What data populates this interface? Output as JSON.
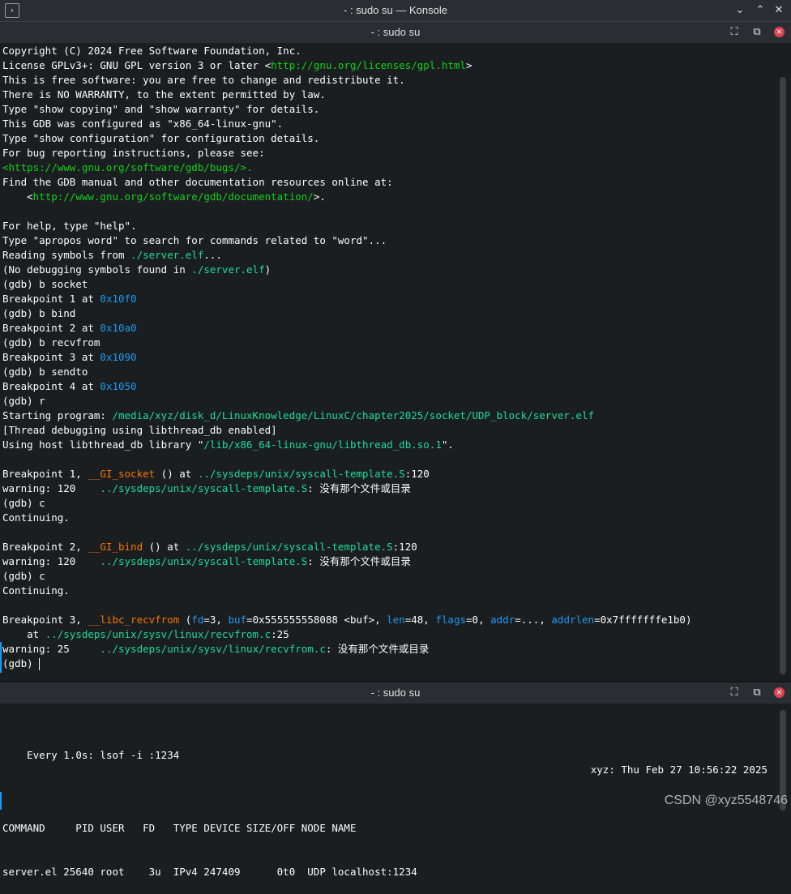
{
  "window": {
    "title": "- : sudo su — Konsole",
    "app_icon": "terminal-icon",
    "controls": [
      "chevron-down-icon",
      "chevron-up-icon",
      "close-icon"
    ]
  },
  "top_pane": {
    "title": "- : sudo su",
    "lines": [
      [
        {
          "t": "Copyright (C) 2024 Free Software Foundation, Inc."
        }
      ],
      [
        {
          "t": "License GPLv3+: GNU GPL version 3 or later <"
        },
        {
          "t": "http://gnu.org/licenses/gpl.html",
          "c": "gn"
        },
        {
          "t": ">"
        }
      ],
      [
        {
          "t": "This is free software: you are free to change and redistribute it."
        }
      ],
      [
        {
          "t": "There is NO WARRANTY, to the extent permitted by law."
        }
      ],
      [
        {
          "t": "Type \"show copying\" and \"show warranty\" for details."
        }
      ],
      [
        {
          "t": "This GDB was configured as \"x86_64-linux-gnu\"."
        }
      ],
      [
        {
          "t": "Type \"show configuration\" for configuration details."
        }
      ],
      [
        {
          "t": "For bug reporting instructions, please see:"
        }
      ],
      [
        {
          "t": "<https://www.gnu.org/software/gdb/bugs/>.",
          "c": "gn"
        }
      ],
      [
        {
          "t": "Find the GDB manual and other documentation resources online at:"
        }
      ],
      [
        {
          "t": "    <"
        },
        {
          "t": "http://www.gnu.org/software/gdb/documentation/",
          "c": "gn"
        },
        {
          "t": ">."
        }
      ],
      [
        {
          "t": ""
        }
      ],
      [
        {
          "t": "For help, type \"help\"."
        }
      ],
      [
        {
          "t": "Type \"apropos word\" to search for commands related to \"word\"..."
        }
      ],
      [
        {
          "t": "Reading symbols from "
        },
        {
          "t": "./server.elf",
          "c": "g"
        },
        {
          "t": "..."
        }
      ],
      [
        {
          "t": "(No debugging symbols found in "
        },
        {
          "t": "./server.elf",
          "c": "g"
        },
        {
          "t": ")"
        }
      ],
      [
        {
          "t": "(gdb) b socket"
        }
      ],
      [
        {
          "t": "Breakpoint 1 at "
        },
        {
          "t": "0x10f0",
          "c": "b"
        }
      ],
      [
        {
          "t": "(gdb) b bind"
        }
      ],
      [
        {
          "t": "Breakpoint 2 at "
        },
        {
          "t": "0x10a0",
          "c": "b"
        }
      ],
      [
        {
          "t": "(gdb) b recvfrom"
        }
      ],
      [
        {
          "t": "Breakpoint 3 at "
        },
        {
          "t": "0x1090",
          "c": "b"
        }
      ],
      [
        {
          "t": "(gdb) b sendto"
        }
      ],
      [
        {
          "t": "Breakpoint 4 at "
        },
        {
          "t": "0x1050",
          "c": "b"
        }
      ],
      [
        {
          "t": "(gdb) r"
        }
      ],
      [
        {
          "t": "Starting program: "
        },
        {
          "t": "/media/xyz/disk_d/LinuxKnowledge/LinuxC/chapter2025/socket/UDP_block/server.elf",
          "c": "g"
        }
      ],
      [
        {
          "t": "[Thread debugging using libthread_db enabled]"
        }
      ],
      [
        {
          "t": "Using host libthread_db library \""
        },
        {
          "t": "/lib/x86_64-linux-gnu/libthread_db.so.1",
          "c": "g"
        },
        {
          "t": "\"."
        }
      ],
      [
        {
          "t": ""
        }
      ],
      [
        {
          "t": "Breakpoint 1, "
        },
        {
          "t": "__GI_socket",
          "c": "o"
        },
        {
          "t": " () at "
        },
        {
          "t": "../sysdeps/unix/syscall-template.S",
          "c": "g"
        },
        {
          "t": ":120"
        }
      ],
      [
        {
          "t": "warning: 120    "
        },
        {
          "t": "../sysdeps/unix/syscall-template.S",
          "c": "g"
        },
        {
          "t": ": 没有那个文件或目录"
        }
      ],
      [
        {
          "t": "(gdb) c"
        }
      ],
      [
        {
          "t": "Continuing."
        }
      ],
      [
        {
          "t": ""
        }
      ],
      [
        {
          "t": "Breakpoint 2, "
        },
        {
          "t": "__GI_bind",
          "c": "o"
        },
        {
          "t": " () at "
        },
        {
          "t": "../sysdeps/unix/syscall-template.S",
          "c": "g"
        },
        {
          "t": ":120"
        }
      ],
      [
        {
          "t": "warning: 120    "
        },
        {
          "t": "../sysdeps/unix/syscall-template.S",
          "c": "g"
        },
        {
          "t": ": 没有那个文件或目录"
        }
      ],
      [
        {
          "t": "(gdb) c"
        }
      ],
      [
        {
          "t": "Continuing."
        }
      ],
      [
        {
          "t": ""
        }
      ],
      [
        {
          "t": "Breakpoint 3, "
        },
        {
          "t": "__libc_recvfrom",
          "c": "o"
        },
        {
          "t": " ("
        },
        {
          "t": "fd",
          "c": "b"
        },
        {
          "t": "=3, "
        },
        {
          "t": "buf",
          "c": "b"
        },
        {
          "t": "=0x555555558088 <buf>, "
        },
        {
          "t": "len",
          "c": "b"
        },
        {
          "t": "=48, "
        },
        {
          "t": "flags",
          "c": "b"
        },
        {
          "t": "=0, "
        },
        {
          "t": "addr",
          "c": "b"
        },
        {
          "t": "=..., "
        },
        {
          "t": "addrlen",
          "c": "b"
        },
        {
          "t": "=0x7fffffffe1b0)"
        }
      ],
      [
        {
          "t": "    at "
        },
        {
          "t": "../sysdeps/unix/sysv/linux/recvfrom.c",
          "c": "g"
        },
        {
          "t": ":25"
        }
      ],
      [
        {
          "t": "warning: 25     "
        },
        {
          "t": "../sysdeps/unix/sysv/linux/recvfrom.c",
          "c": "g"
        },
        {
          "t": ": 没有那个文件或目录"
        }
      ],
      [
        {
          "t": "(gdb) "
        }
      ]
    ]
  },
  "bottom_pane": {
    "title": "- : sudo su",
    "watch_cmd": "Every 1.0s: lsof -i :1234",
    "watch_host_time": "xyz: Thu Feb 27 10:56:22 2025",
    "header": "COMMAND     PID USER   FD   TYPE DEVICE SIZE/OFF NODE NAME",
    "row": "server.el 25640 root    3u  IPv4 247409      0t0  UDP localhost:1234"
  },
  "watermark": "CSDN @xyz5548746",
  "colors": {
    "path": "#1cdc9a",
    "addr": "#1d99f3",
    "func": "#f67400",
    "url": "#11d116",
    "fg": "#fcfcfc",
    "bg": "#1b1e20"
  }
}
